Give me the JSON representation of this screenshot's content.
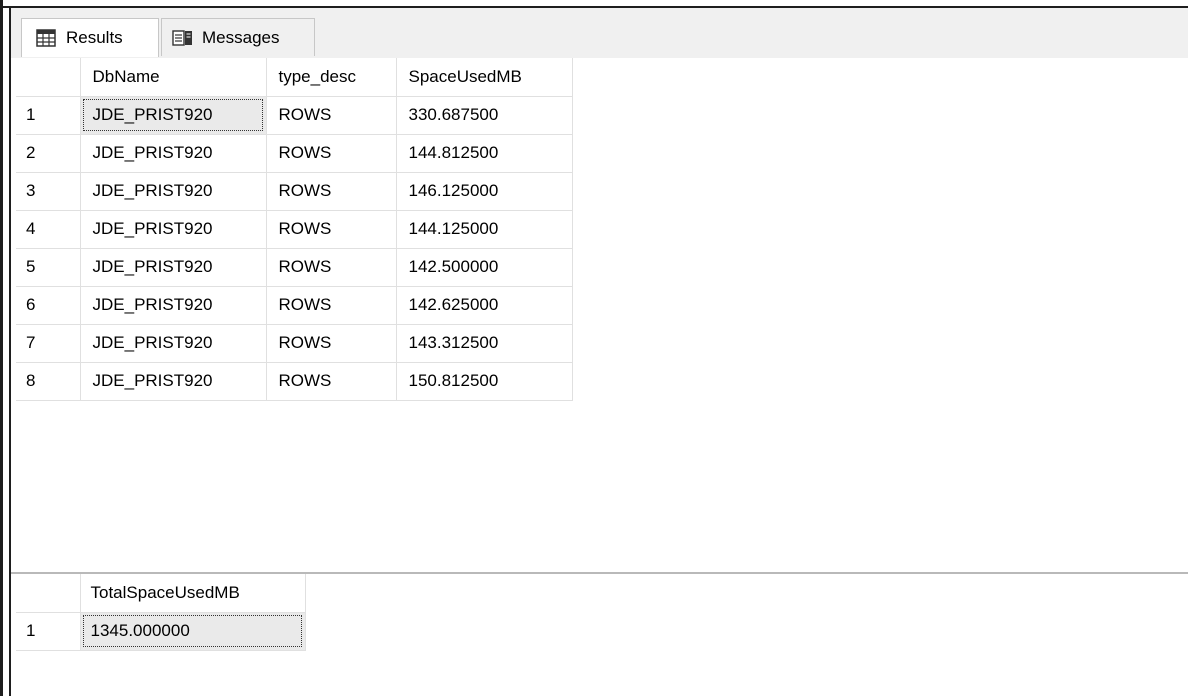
{
  "tabs": {
    "results_label": "Results",
    "messages_label": "Messages"
  },
  "grid1": {
    "columns": [
      "DbName",
      "type_desc",
      "SpaceUsedMB"
    ],
    "rows": [
      {
        "num": "1",
        "DbName": "JDE_PRIST920",
        "type_desc": "ROWS",
        "SpaceUsedMB": "330.687500"
      },
      {
        "num": "2",
        "DbName": "JDE_PRIST920",
        "type_desc": "ROWS",
        "SpaceUsedMB": "144.812500"
      },
      {
        "num": "3",
        "DbName": "JDE_PRIST920",
        "type_desc": "ROWS",
        "SpaceUsedMB": "146.125000"
      },
      {
        "num": "4",
        "DbName": "JDE_PRIST920",
        "type_desc": "ROWS",
        "SpaceUsedMB": "144.125000"
      },
      {
        "num": "5",
        "DbName": "JDE_PRIST920",
        "type_desc": "ROWS",
        "SpaceUsedMB": "142.500000"
      },
      {
        "num": "6",
        "DbName": "JDE_PRIST920",
        "type_desc": "ROWS",
        "SpaceUsedMB": "142.625000"
      },
      {
        "num": "7",
        "DbName": "JDE_PRIST920",
        "type_desc": "ROWS",
        "SpaceUsedMB": "143.312500"
      },
      {
        "num": "8",
        "DbName": "JDE_PRIST920",
        "type_desc": "ROWS",
        "SpaceUsedMB": "150.812500"
      }
    ]
  },
  "grid2": {
    "columns": [
      "TotalSpaceUsedMB"
    ],
    "rows": [
      {
        "num": "1",
        "TotalSpaceUsedMB": "1345.000000"
      }
    ]
  },
  "icons": {
    "results": "grid-icon",
    "messages": "messages-icon"
  }
}
